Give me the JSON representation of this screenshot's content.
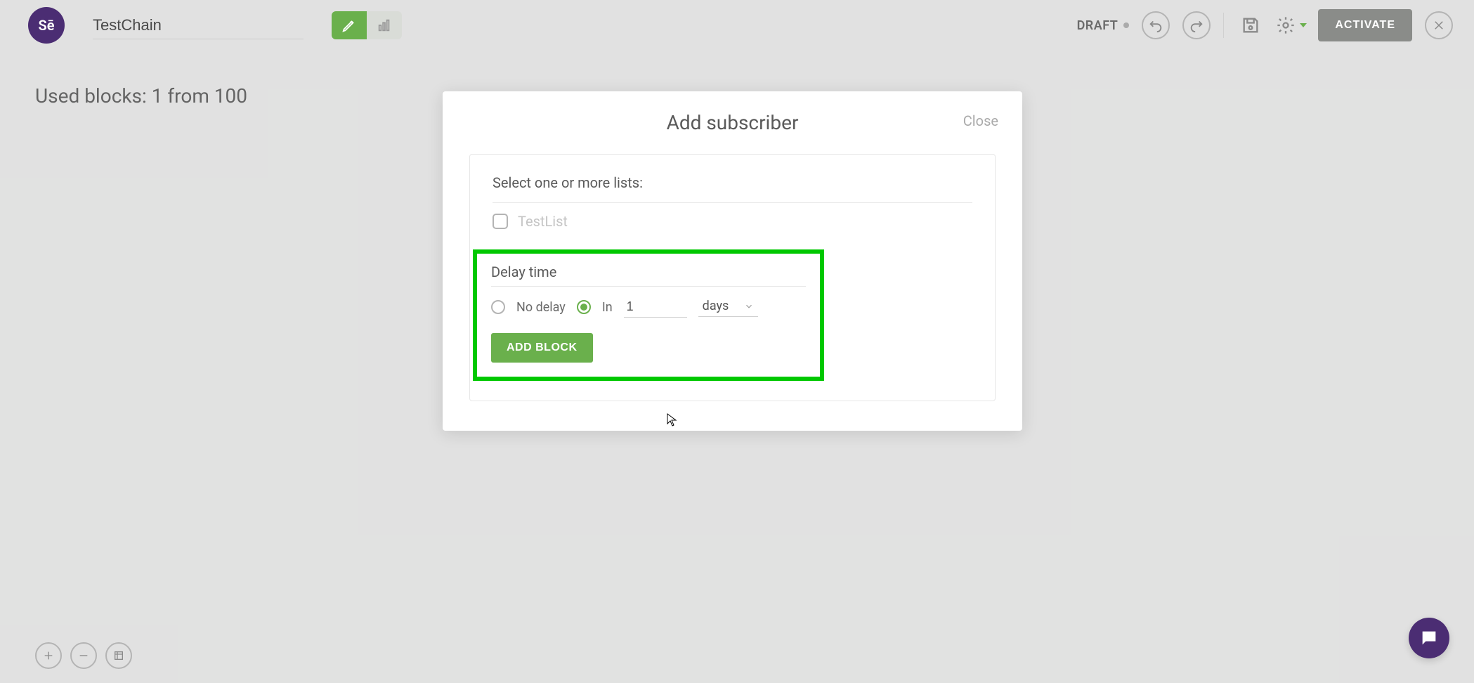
{
  "header": {
    "logo_text": "Sē",
    "chain_name": "TestChain",
    "status_label": "DRAFT",
    "activate_label": "ACTIVATE"
  },
  "used_blocks": {
    "text": "Used blocks: 1 from 100"
  },
  "modal": {
    "title": "Add subscriber",
    "close_label": "Close",
    "lists_label": "Select one or more lists:",
    "list_item": "TestList",
    "delay_label": "Delay time",
    "radio_no_delay": "No delay",
    "radio_in": "In",
    "delay_value": "1",
    "delay_unit": "days",
    "add_block_label": "ADD BLOCK"
  }
}
